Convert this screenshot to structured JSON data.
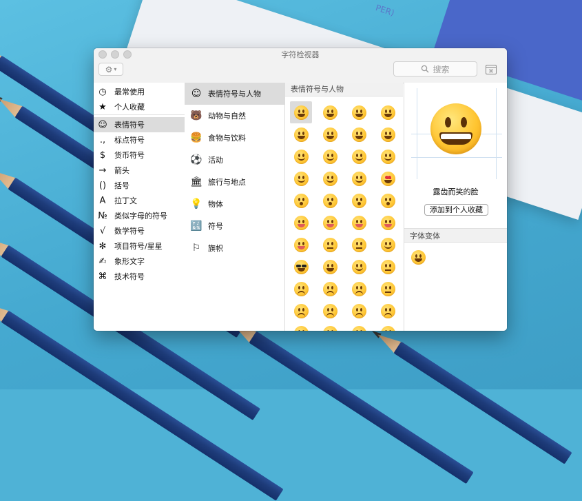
{
  "background": {
    "paper_text": "PER)"
  },
  "window": {
    "title": "字符检视器"
  },
  "toolbar": {
    "gear_icon": "gear-icon",
    "search_placeholder": "搜索",
    "grid_icon": "keyboard-grid-icon"
  },
  "sidebar": {
    "items": [
      {
        "icon": "clock-icon",
        "glyph": "◷",
        "label": "最常使用",
        "selected": false
      },
      {
        "icon": "star-icon",
        "glyph": "★",
        "label": "个人收藏",
        "selected": false
      },
      {
        "icon": "smiley-icon",
        "glyph": "☺",
        "label": "表情符号",
        "selected": true
      },
      {
        "icon": "punctuation-icon",
        "glyph": ".,",
        "label": "标点符号",
        "selected": false
      },
      {
        "icon": "dollar-icon",
        "glyph": "$",
        "label": "货币符号",
        "selected": false
      },
      {
        "icon": "arrow-icon",
        "glyph": "→",
        "label": "箭头",
        "selected": false
      },
      {
        "icon": "parentheses-icon",
        "glyph": "()",
        "label": "括号",
        "selected": false
      },
      {
        "icon": "latin-a-icon",
        "glyph": "A",
        "label": "拉丁文",
        "selected": false
      },
      {
        "icon": "numero-icon",
        "glyph": "№",
        "label": "类似字母的符号",
        "selected": false
      },
      {
        "icon": "sqrt-icon",
        "glyph": "√",
        "label": "数学符号",
        "selected": false
      },
      {
        "icon": "asterisk-icon",
        "glyph": "✻",
        "label": "项目符号/星星",
        "selected": false
      },
      {
        "icon": "pictograph-icon",
        "glyph": "✍",
        "label": "象形文字",
        "selected": false
      },
      {
        "icon": "command-icon",
        "glyph": "⌘",
        "label": "技术符号",
        "selected": false
      }
    ]
  },
  "categories": {
    "items": [
      {
        "icon": "smiley-icon",
        "glyph": "☺",
        "label": "表情符号与人物",
        "selected": true
      },
      {
        "icon": "bear-icon",
        "glyph": "🐻",
        "label": "动物与自然",
        "selected": false
      },
      {
        "icon": "food-icon",
        "glyph": "🍔",
        "label": "食物与饮料",
        "selected": false
      },
      {
        "icon": "soccer-ball-icon",
        "glyph": "⚽",
        "label": "活动",
        "selected": false
      },
      {
        "icon": "building-icon",
        "glyph": "🏛",
        "label": "旅行与地点",
        "selected": false
      },
      {
        "icon": "lightbulb-icon",
        "glyph": "💡",
        "label": "物体",
        "selected": false
      },
      {
        "icon": "symbols-icon",
        "glyph": "🔣",
        "label": "符号",
        "selected": false
      },
      {
        "icon": "flag-icon",
        "glyph": "⚐",
        "label": "旗帜",
        "selected": false
      }
    ]
  },
  "grid": {
    "header": "表情符号与人物",
    "emojis": [
      {
        "name": "grinning-face",
        "style": "",
        "selected": true
      },
      {
        "name": "grinning-face-big-eyes",
        "style": ""
      },
      {
        "name": "grinning-face-smiling-eyes",
        "style": ""
      },
      {
        "name": "beaming-face",
        "style": ""
      },
      {
        "name": "grinning-squinting-face",
        "style": ""
      },
      {
        "name": "grinning-face-sweat",
        "style": ""
      },
      {
        "name": "face-tears-of-joy",
        "style": ""
      },
      {
        "name": "rolling-on-floor-laughing",
        "style": ""
      },
      {
        "name": "smiling-face",
        "style": "m-smile"
      },
      {
        "name": "smiling-face-smiling-eyes",
        "style": "m-smile"
      },
      {
        "name": "smiling-face-halo",
        "style": "m-smile"
      },
      {
        "name": "slightly-smiling-face",
        "style": "m-smile"
      },
      {
        "name": "upside-down-face",
        "style": "m-smile"
      },
      {
        "name": "winking-face",
        "style": "m-smile"
      },
      {
        "name": "relieved-face",
        "style": "m-smile"
      },
      {
        "name": "heart-eyes",
        "style": "heart"
      },
      {
        "name": "face-blowing-kiss",
        "style": "m-open"
      },
      {
        "name": "kissing-face",
        "style": "m-open"
      },
      {
        "name": "kissing-face-smiling-eyes",
        "style": "m-open"
      },
      {
        "name": "kissing-face-closed-eyes",
        "style": "m-open"
      },
      {
        "name": "face-savoring-food",
        "style": "m-tongue"
      },
      {
        "name": "face-with-tongue",
        "style": "m-tongue"
      },
      {
        "name": "squinting-face-tongue",
        "style": "m-tongue"
      },
      {
        "name": "winking-face-tongue",
        "style": "m-tongue"
      },
      {
        "name": "zany-face",
        "style": "m-tongue"
      },
      {
        "name": "face-raised-eyebrow",
        "style": "m-flat"
      },
      {
        "name": "face-monocle",
        "style": "m-flat"
      },
      {
        "name": "nerd-face",
        "style": "m-smile"
      },
      {
        "name": "smiling-face-sunglasses",
        "style": "shades"
      },
      {
        "name": "star-struck",
        "style": ""
      },
      {
        "name": "smirking-face",
        "style": "m-smile"
      },
      {
        "name": "unamused-face",
        "style": "m-flat"
      },
      {
        "name": "disappointed-face",
        "style": "m-frown"
      },
      {
        "name": "pensive-face",
        "style": "m-frown"
      },
      {
        "name": "worried-face",
        "style": "m-frown"
      },
      {
        "name": "confused-face",
        "style": "m-flat"
      },
      {
        "name": "slightly-frowning-face",
        "style": "m-frown"
      },
      {
        "name": "frowning-face",
        "style": "m-frown"
      },
      {
        "name": "persevering-face",
        "style": "m-frown"
      },
      {
        "name": "confounded-face",
        "style": "m-frown"
      },
      {
        "name": "tired-face",
        "style": "m-frown"
      },
      {
        "name": "weary-face",
        "style": "m-frown"
      },
      {
        "name": "pleading-face",
        "style": "m-frown"
      },
      {
        "name": "crying-face",
        "style": "m-frown"
      }
    ]
  },
  "detail": {
    "name": "露齿而笑的脸",
    "add_favorite_label": "添加到个人收藏",
    "variants_header": "字体变体"
  },
  "colors": {
    "selection": "#dcdcdc",
    "desktop": "#4fb2d6",
    "pencil": "#1e3c7a"
  }
}
